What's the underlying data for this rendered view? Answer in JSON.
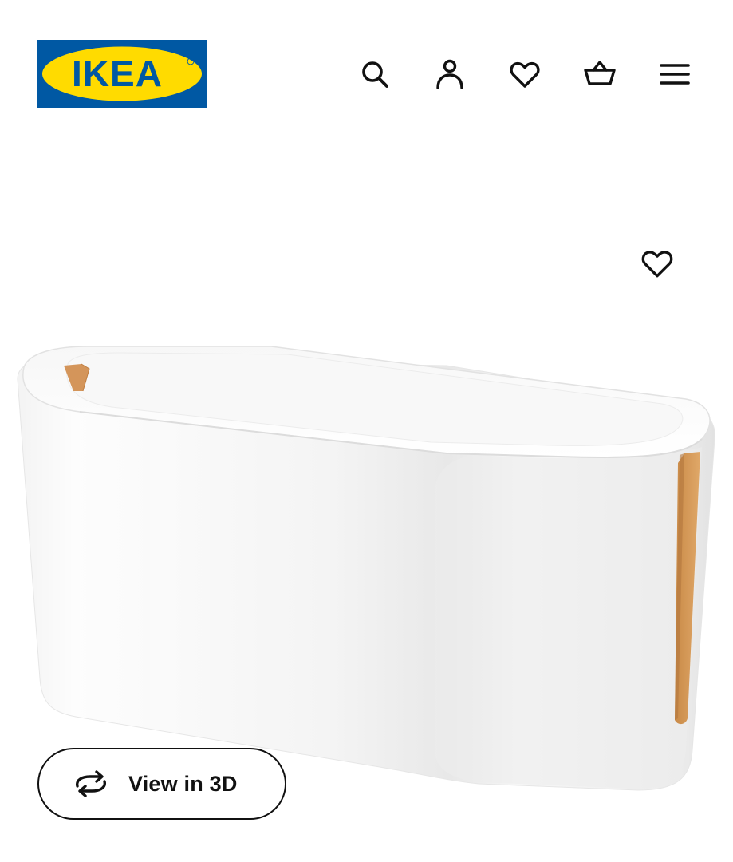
{
  "header": {
    "logo_text": "IKEA",
    "icons": [
      "search-icon",
      "account-icon",
      "favourites-icon",
      "basket-icon",
      "menu-icon"
    ]
  },
  "product": {
    "favourite_icon": "heart-outline-icon",
    "view_3d_label": "View in 3D",
    "view_3d_icon": "rotate-3d-icon"
  },
  "colors": {
    "brand_blue": "#0058a3",
    "brand_yellow": "#ffdb00",
    "text": "#111111"
  }
}
